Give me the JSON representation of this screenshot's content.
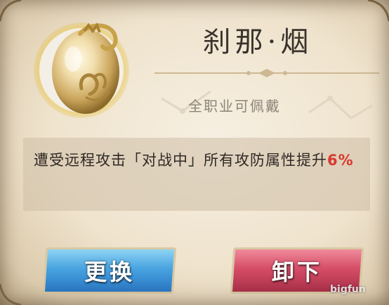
{
  "item": {
    "name": "刹那·烟",
    "restriction": "全职业可佩戴",
    "icon": "golden-dragon-egg-icon",
    "description_main": "遭受远程攻击「对战中」所有攻防属性提升",
    "description_value": "6%"
  },
  "buttons": {
    "replace_label": "更换",
    "unequip_label": "卸下"
  },
  "watermark": "bigfun",
  "colors": {
    "highlight": "#d8392f",
    "replace_button": "#48a3e0",
    "unequip_button": "#d64d66"
  }
}
